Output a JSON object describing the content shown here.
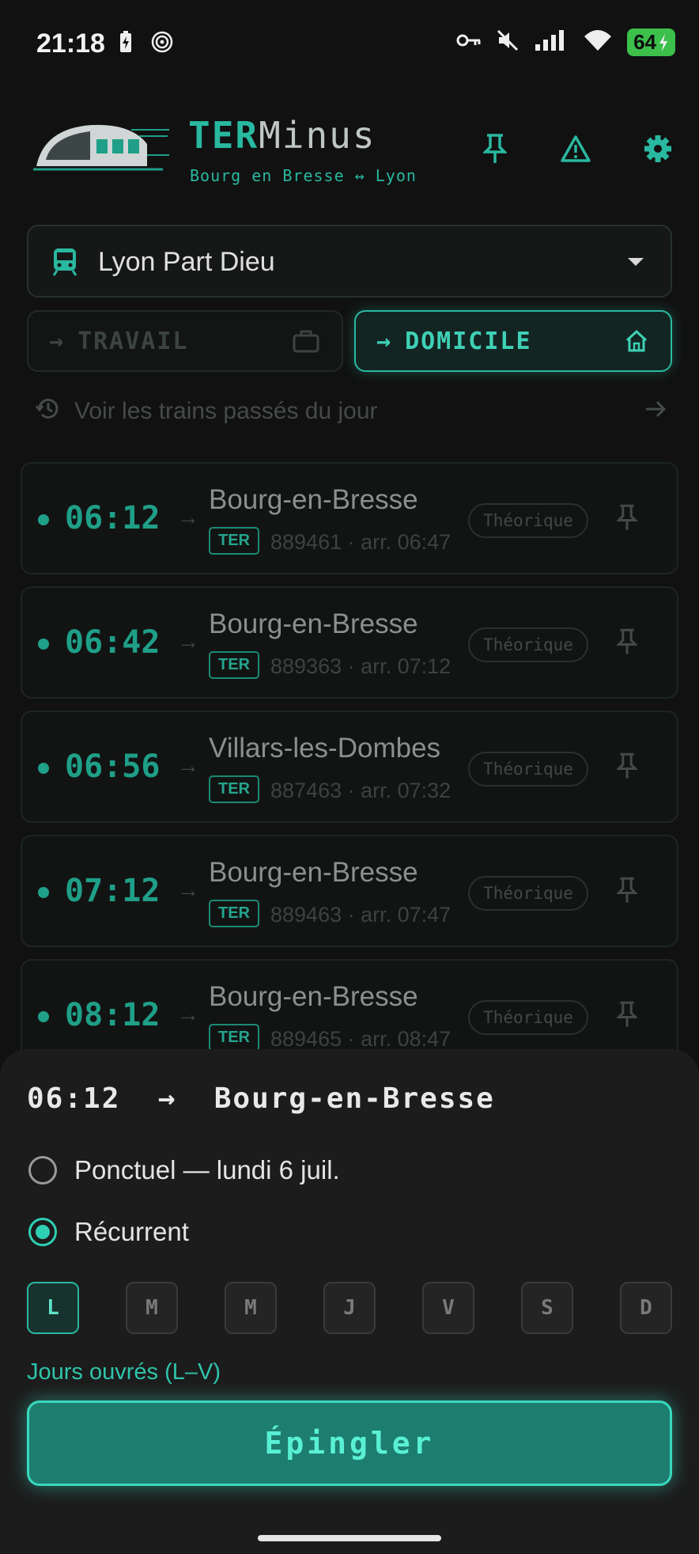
{
  "status_bar": {
    "time": "21:18",
    "battery": "64"
  },
  "app": {
    "title_part1": "TER",
    "title_part2": "Minus",
    "subtitle": "Bourg en Bresse ↔ Lyon"
  },
  "station": {
    "name": "Lyon Part Dieu"
  },
  "directions": {
    "work_label": "TRAVAIL",
    "home_label": "DOMICILE",
    "arrow": "→"
  },
  "past_trains_link": "Voir les trains passés du jour",
  "trains": [
    {
      "time": "06:12",
      "destination": "Bourg-en-Bresse",
      "type": "TER",
      "details": "889461 · arr. 06:47",
      "status": "Théorique"
    },
    {
      "time": "06:42",
      "destination": "Bourg-en-Bresse",
      "type": "TER",
      "details": "889363 · arr. 07:12",
      "status": "Théorique"
    },
    {
      "time": "06:56",
      "destination": "Villars-les-Dombes",
      "type": "TER",
      "details": "887463 · arr. 07:32",
      "status": "Théorique"
    },
    {
      "time": "07:12",
      "destination": "Bourg-en-Bresse",
      "type": "TER",
      "details": "889463 · arr. 07:47",
      "status": "Théorique"
    },
    {
      "time": "08:12",
      "destination": "Bourg-en-Bresse",
      "type": "TER",
      "details": "889465 · arr. 08:47",
      "status": "Théorique"
    }
  ],
  "sheet": {
    "title": "06:12  →  Bourg-en-Bresse",
    "option_once": "Ponctuel — lundi 6 juil.",
    "option_recurring": "Récurrent",
    "selected_option": "recurring",
    "days": [
      {
        "label": "L",
        "selected": true
      },
      {
        "label": "M",
        "selected": false
      },
      {
        "label": "M",
        "selected": false
      },
      {
        "label": "J",
        "selected": false
      },
      {
        "label": "V",
        "selected": false
      },
      {
        "label": "S",
        "selected": false
      },
      {
        "label": "D",
        "selected": false
      }
    ],
    "days_hint": "Jours ouvrés (L–V)",
    "pin_button": "Épingler"
  },
  "colors": {
    "accent": "#29b8a0",
    "background": "#111111",
    "sheet": "#1c1c1c"
  },
  "icons": [
    "charging-icon",
    "hotspot-icon",
    "key-icon",
    "mute-icon",
    "signal-icon",
    "wifi-icon",
    "pin-icon",
    "warning-icon",
    "gear-icon",
    "train-icon",
    "briefcase-icon",
    "home-icon",
    "history-icon",
    "arrow-right-icon"
  ]
}
